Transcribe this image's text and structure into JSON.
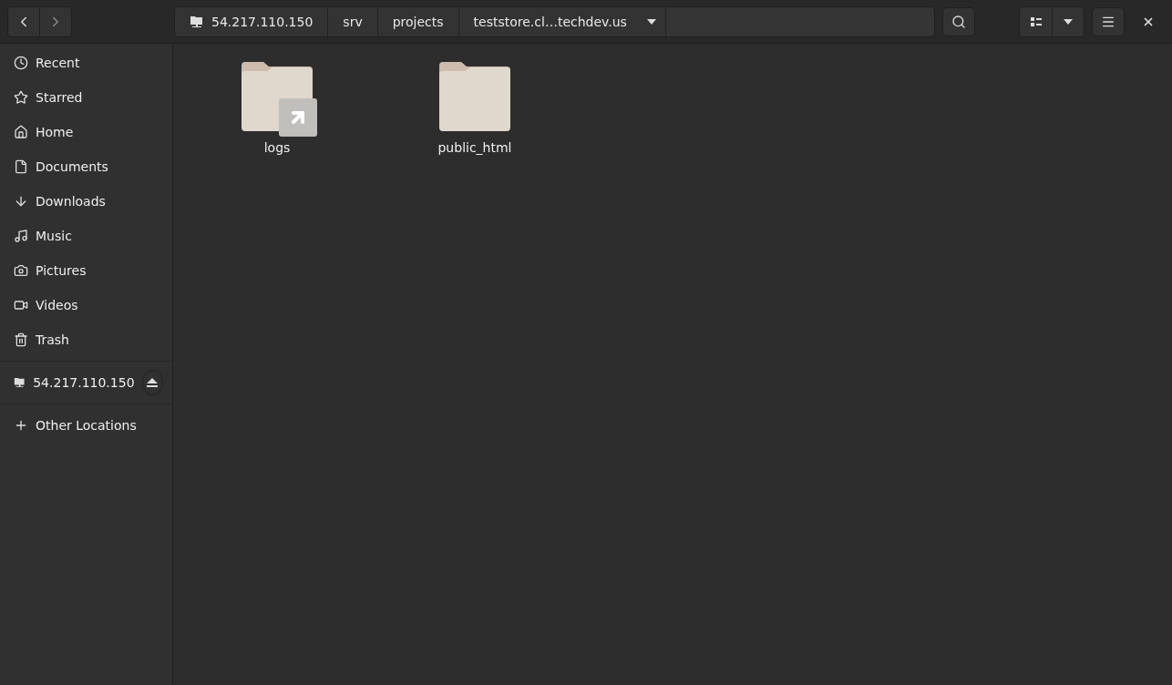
{
  "path": [
    {
      "label": "54.217.110.150",
      "kind": "root"
    },
    {
      "label": "srv",
      "kind": "dir"
    },
    {
      "label": "projects",
      "kind": "dir"
    },
    {
      "label": "teststore.cl…techdev.us",
      "kind": "current"
    }
  ],
  "sidebar": {
    "places": [
      "Recent",
      "Starred",
      "Home",
      "Documents",
      "Downloads",
      "Music",
      "Pictures",
      "Videos",
      "Trash"
    ],
    "mounts": [
      "54.217.110.150"
    ],
    "other": [
      "Other Locations"
    ]
  },
  "files": [
    {
      "name": "logs",
      "link": true
    },
    {
      "name": "public_html",
      "link": false
    }
  ]
}
